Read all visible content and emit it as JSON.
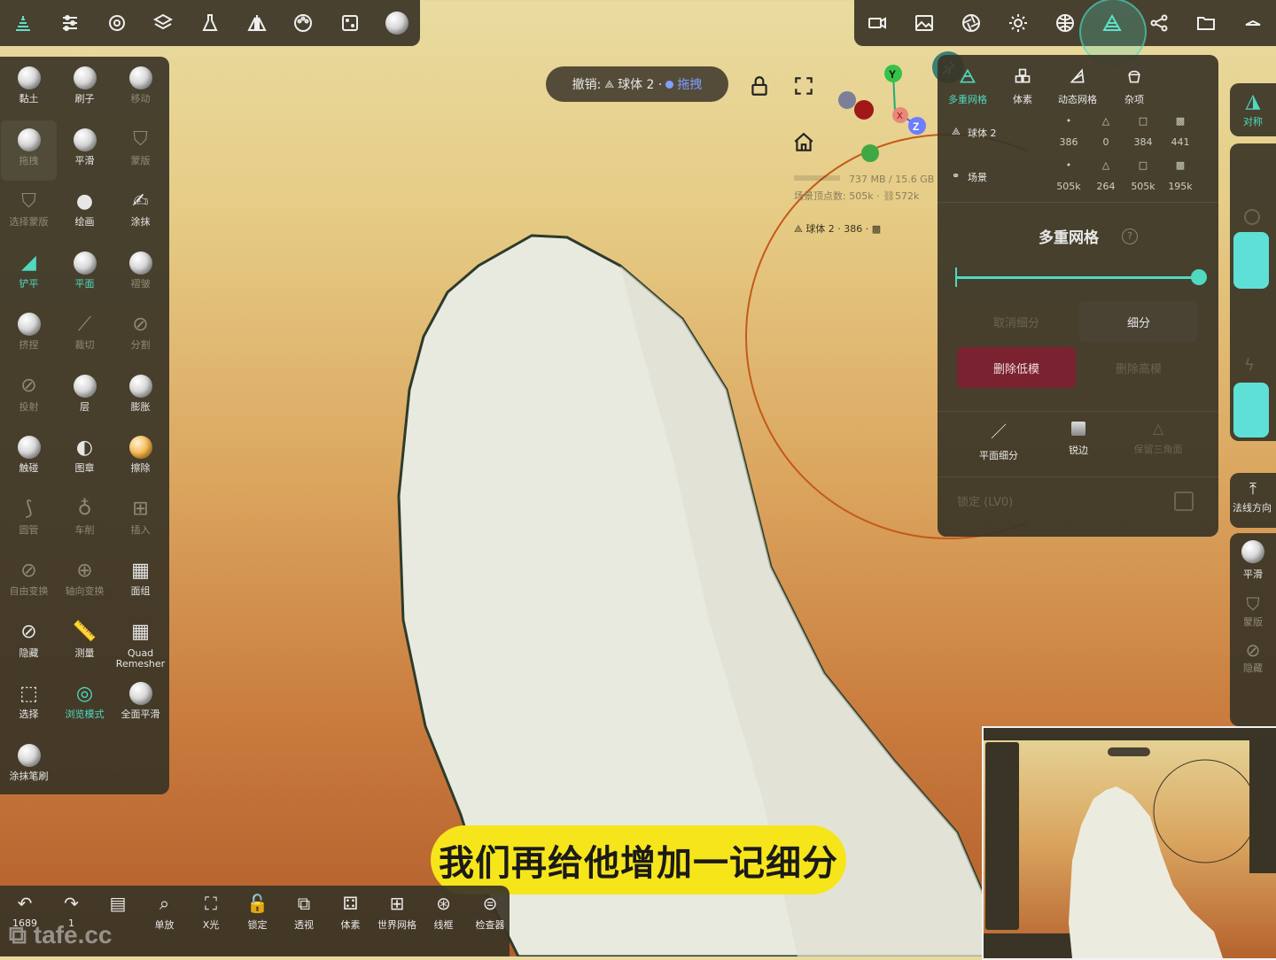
{
  "topbar_left": {
    "icons": [
      "layers-stack-icon",
      "sliders-icon",
      "gear-icon",
      "layers-icon",
      "flask-icon",
      "symmetry-icon",
      "palette-icon",
      "dice-icon",
      "material-sphere-icon"
    ]
  },
  "topbar_right": {
    "icons": [
      "camera-icon",
      "image-icon",
      "aperture-icon",
      "sun-icon",
      "globe-grid-icon",
      "multires-icon",
      "share-graph-icon",
      "folder-icon",
      "dropdown-icon"
    ]
  },
  "tools": [
    {
      "label": "黏土",
      "style": "white"
    },
    {
      "label": "刷子",
      "style": "white"
    },
    {
      "label": "移动",
      "style": "dim"
    },
    {
      "label": "拖拽",
      "style": "dim"
    },
    {
      "label": "平滑",
      "style": "white"
    },
    {
      "label": "蒙版",
      "style": "dim"
    },
    {
      "label": "选择蒙版",
      "style": "dim"
    },
    {
      "label": "绘画",
      "style": "white"
    },
    {
      "label": "涂抹",
      "style": "white"
    },
    {
      "label": "铲平",
      "style": "teal"
    },
    {
      "label": "平面",
      "style": "teal"
    },
    {
      "label": "褶皱",
      "style": "dim"
    },
    {
      "label": "挤捏",
      "style": "dim"
    },
    {
      "label": "裁切",
      "style": "dim"
    },
    {
      "label": "分割",
      "style": "dim"
    },
    {
      "label": "投射",
      "style": "dim"
    },
    {
      "label": "层",
      "style": "white"
    },
    {
      "label": "膨胀",
      "style": "white"
    },
    {
      "label": "触碰",
      "style": "white"
    },
    {
      "label": "图章",
      "style": "white"
    },
    {
      "label": "擦除",
      "style": "white"
    },
    {
      "label": "圆管",
      "style": "dim"
    },
    {
      "label": "车削",
      "style": "dim"
    },
    {
      "label": "插入",
      "style": "dim"
    },
    {
      "label": "自由变换",
      "style": "dim"
    },
    {
      "label": "轴向变换",
      "style": "dim"
    },
    {
      "label": "面组",
      "style": "white"
    },
    {
      "label": "隐藏",
      "style": "white"
    },
    {
      "label": "测量",
      "style": "white"
    },
    {
      "label": "Quad Remesher",
      "style": "white"
    },
    {
      "label": "选择",
      "style": "white"
    },
    {
      "label": "浏览模式",
      "style": "teal"
    },
    {
      "label": "全面平滑",
      "style": "white"
    },
    {
      "label": "涂抹笔刷",
      "style": "white"
    }
  ],
  "undo": {
    "prefix": "撤销:",
    "object": "球体 2 ·",
    "action": "拖拽"
  },
  "viewport": {
    "memory": "737 MB / 15.6 GB",
    "scene_verts": "场景顶点数: 505k · ",
    "scene_faces": "572k",
    "selected": "球体 2 · 386 ·",
    "gizmo_axes": [
      "X",
      "Y",
      "Z"
    ]
  },
  "right_panel": {
    "tabs": [
      {
        "label": "多重网格",
        "active": true
      },
      {
        "label": "体素",
        "active": false
      },
      {
        "label": "动态网格",
        "active": false
      },
      {
        "label": "杂项",
        "active": false
      }
    ],
    "rows": [
      {
        "name": "球体 2",
        "stats": [
          "386",
          "0",
          "384",
          "441"
        ]
      },
      {
        "name": "场景",
        "stats": [
          "505k",
          "264",
          "505k",
          "195k"
        ]
      }
    ],
    "section_title": "多重网格",
    "slider_value": 1.0,
    "buttons": {
      "reverse": "取消细分",
      "subdivide": "细分",
      "delete_lower": "删除低模",
      "delete_higher": "删除高模"
    },
    "options": [
      {
        "label": "平面细分",
        "active": true
      },
      {
        "label": "锐边",
        "active": true
      },
      {
        "label": "保留三角面",
        "active": false
      }
    ],
    "lock_label": "锁定 (LV0)"
  },
  "right_strip": {
    "symmetry": "对称",
    "normal": "法线方向",
    "smooth": "平滑",
    "mask": "蒙版",
    "hide": "隐藏"
  },
  "subtitle": "我们再给他增加一记细分",
  "bottom_bar": [
    {
      "label": "1689",
      "icon": "undo-icon"
    },
    {
      "label": "1",
      "icon": "redo-icon"
    },
    {
      "label": "",
      "icon": "document-icon"
    },
    {
      "label": "单放",
      "icon": "zoom-icon"
    },
    {
      "label": "X光",
      "icon": "xray-icon"
    },
    {
      "label": "锁定",
      "icon": "lock-icon"
    },
    {
      "label": "透视",
      "icon": "perspective-icon"
    },
    {
      "label": "体素",
      "icon": "voxel-icon"
    },
    {
      "label": "世界网格",
      "icon": "world-grid-icon"
    },
    {
      "label": "线框",
      "icon": "wireframe-icon"
    },
    {
      "label": "检查器",
      "icon": "inspector-icon"
    }
  ],
  "watermark": "tafe.cc",
  "colors": {
    "accent": "#4ed9c0",
    "danger_button": "#7a2230",
    "subtitle_bg": "#f6e51b",
    "panel": "#3a3426"
  }
}
